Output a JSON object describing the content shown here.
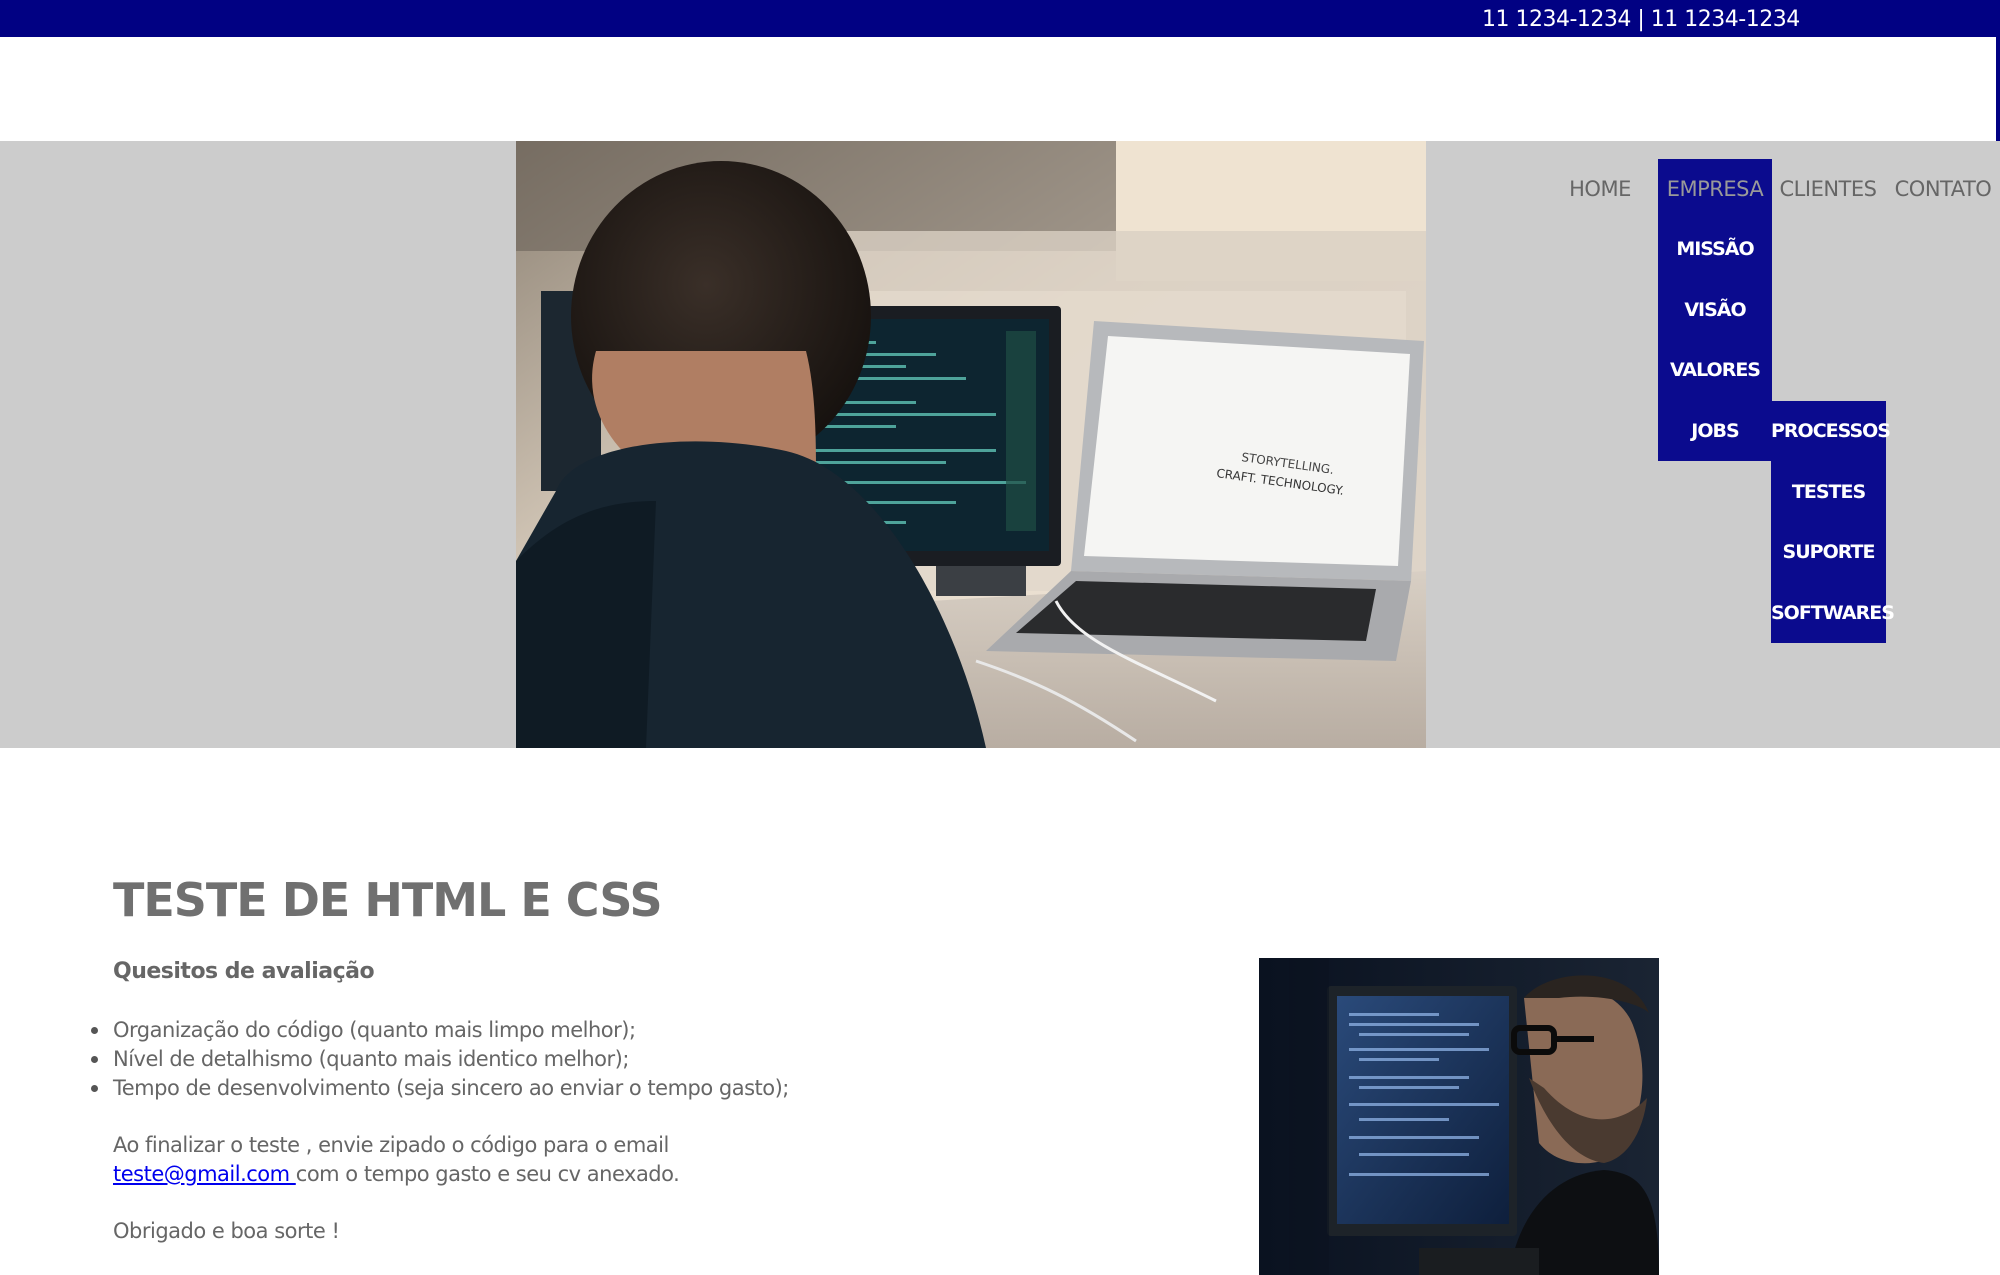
{
  "topbar": {
    "phones": "11 1234-1234 | 11 1234-1234",
    "background": "#010183"
  },
  "hero": {
    "background": "#cccccc",
    "photo_text_line1": "STORYTELLING.",
    "photo_text_line2": "CRAFT. TECHNOLOGY."
  },
  "nav": {
    "items": [
      {
        "label": "HOME"
      },
      {
        "label": "EMPRESA"
      },
      {
        "label": "CLIENTES"
      },
      {
        "label": "CONTATO"
      }
    ],
    "active_background": "#0b0b8e",
    "empresa_submenu": [
      "MISSÃO",
      "VISÃO",
      "VALORES",
      "JOBS"
    ],
    "jobs_submenu": [
      "PROCESSOS",
      "TESTES",
      "SUPORTE",
      "SOFTWARES"
    ]
  },
  "content": {
    "title": "TESTE DE HTML E CSS",
    "subtitle": "Quesitos de avaliação",
    "criteria": [
      "Organização do código (quanto mais limpo melhor);",
      "Nível de detalhismo (quanto mais identico melhor);",
      "Tempo de desenvolvimento (seja sincero ao enviar o tempo gasto);"
    ],
    "finish_text": "Ao finalizar o teste , envie zipado o código para o email",
    "email": "teste@gmail.com ",
    "email_suffix": "com o tempo gasto e seu cv anexado.",
    "thanks": "Obrigado e boa sorte !"
  }
}
